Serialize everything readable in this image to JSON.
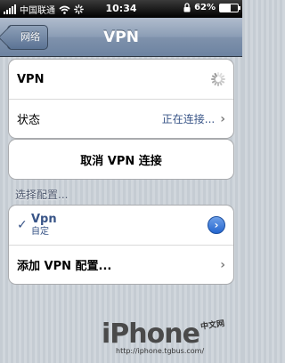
{
  "status_bar": {
    "carrier": "中国联通",
    "time": "10:34",
    "battery_percent_label": "62%",
    "battery_level": 0.62,
    "icons": [
      "signal-bars-icon",
      "wifi-icon",
      "activity-spinner-icon",
      "lock-icon",
      "battery-icon"
    ]
  },
  "nav": {
    "back_label": "网络",
    "title": "VPN"
  },
  "vpn_group": {
    "vpn_label": "VPN",
    "status_label": "状态",
    "status_value": "正在连接...",
    "chevron": "›"
  },
  "cancel_button": {
    "label": "取消 VPN 连接"
  },
  "config_section": {
    "header": "选择配置...",
    "items": [
      {
        "name": "Vpn",
        "subtitle": "自定",
        "checked": true,
        "check": "✓",
        "disclosure": "›"
      },
      {
        "name": "添加 VPN 配置...",
        "chevron": "›"
      }
    ]
  },
  "watermark": {
    "logo": "iPhone",
    "sub": "中文网",
    "url": "http://iphone.tgbus.com/"
  },
  "colors": {
    "nav_blue": "#6d83a1",
    "value_blue": "#385487",
    "disclosure_blue": "#2466cf"
  }
}
